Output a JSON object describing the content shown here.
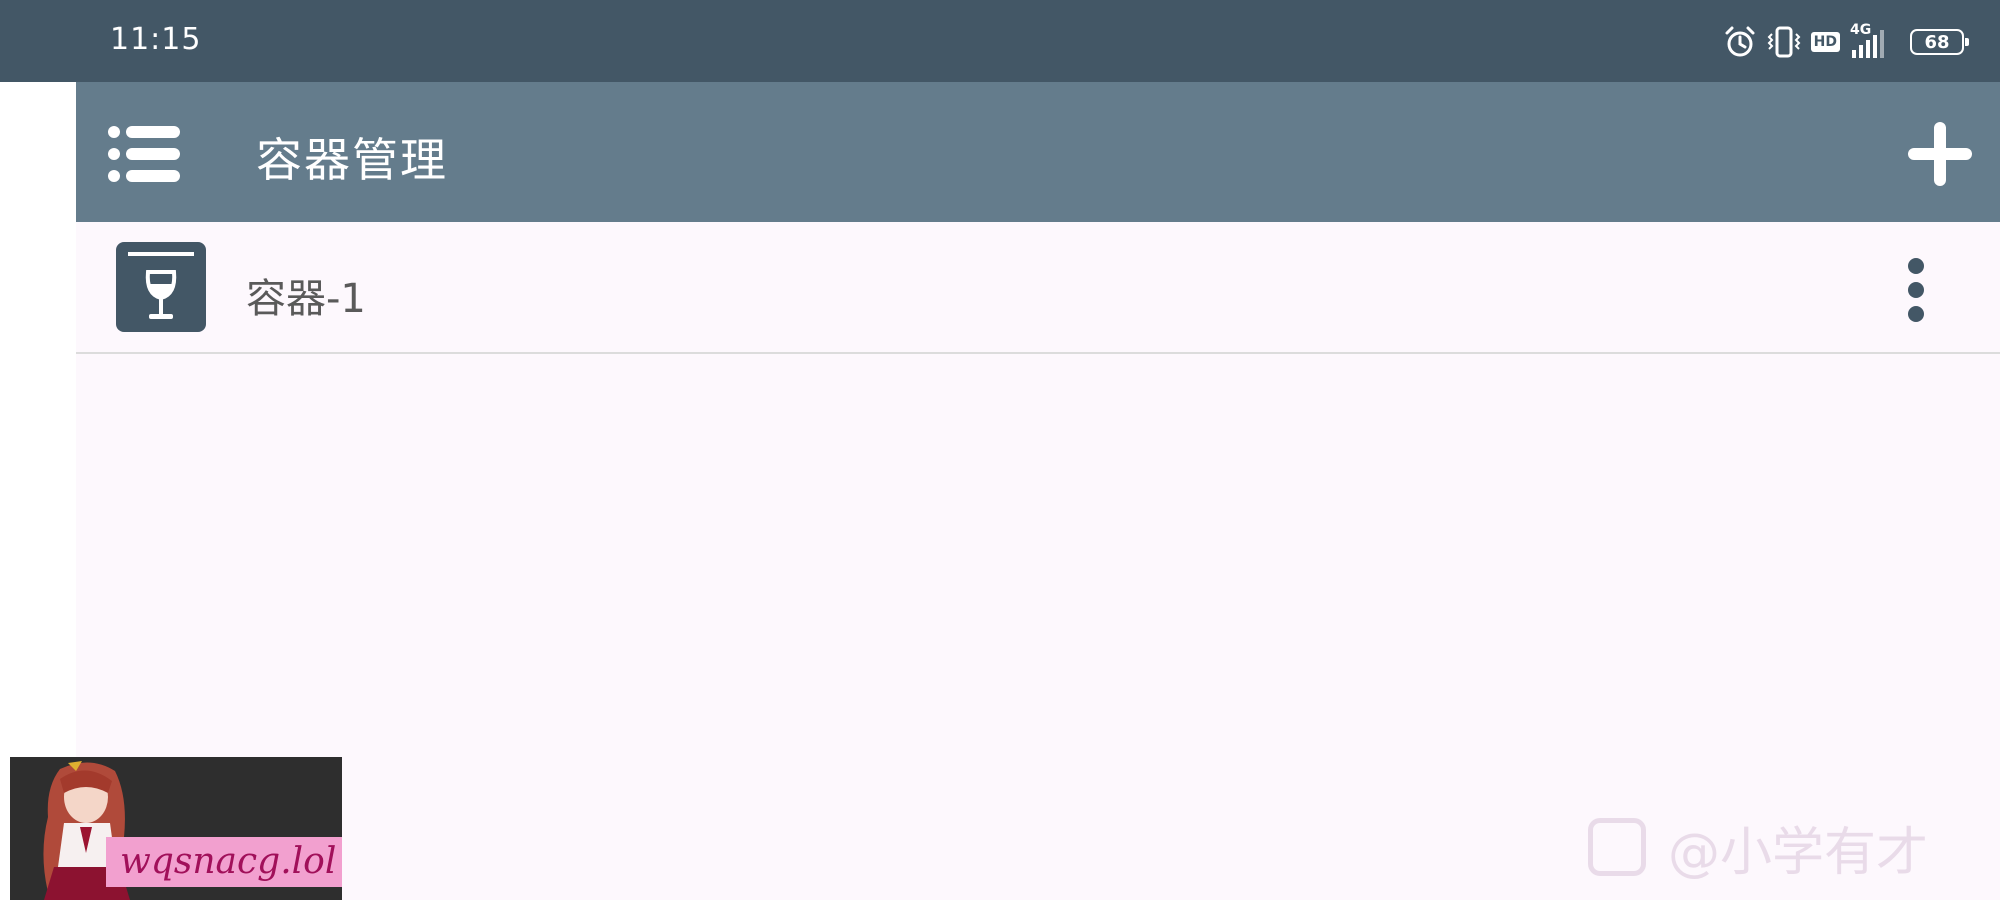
{
  "status_bar": {
    "time": "11:15",
    "icons": [
      "alarm-icon",
      "vibrate-icon",
      "hd-icon",
      "signal-4g-icon",
      "battery-icon"
    ],
    "hd_label": "HD",
    "network_label": "4G",
    "battery_level": "68"
  },
  "toolbar": {
    "title": "容器管理",
    "menu_icon": "menu-list-icon",
    "add_icon": "plus-icon"
  },
  "containers": [
    {
      "label": "容器-1",
      "icon": "wine-glass-icon",
      "more_icon": "more-vertical-icon"
    }
  ],
  "overlay": {
    "promo_text": "wqsnacg.lol",
    "watermark_text": "@小学有才"
  },
  "colors": {
    "status_bar": "#435766",
    "toolbar": "#647c8c",
    "background": "#fdf8fd",
    "accent": "#435766"
  }
}
